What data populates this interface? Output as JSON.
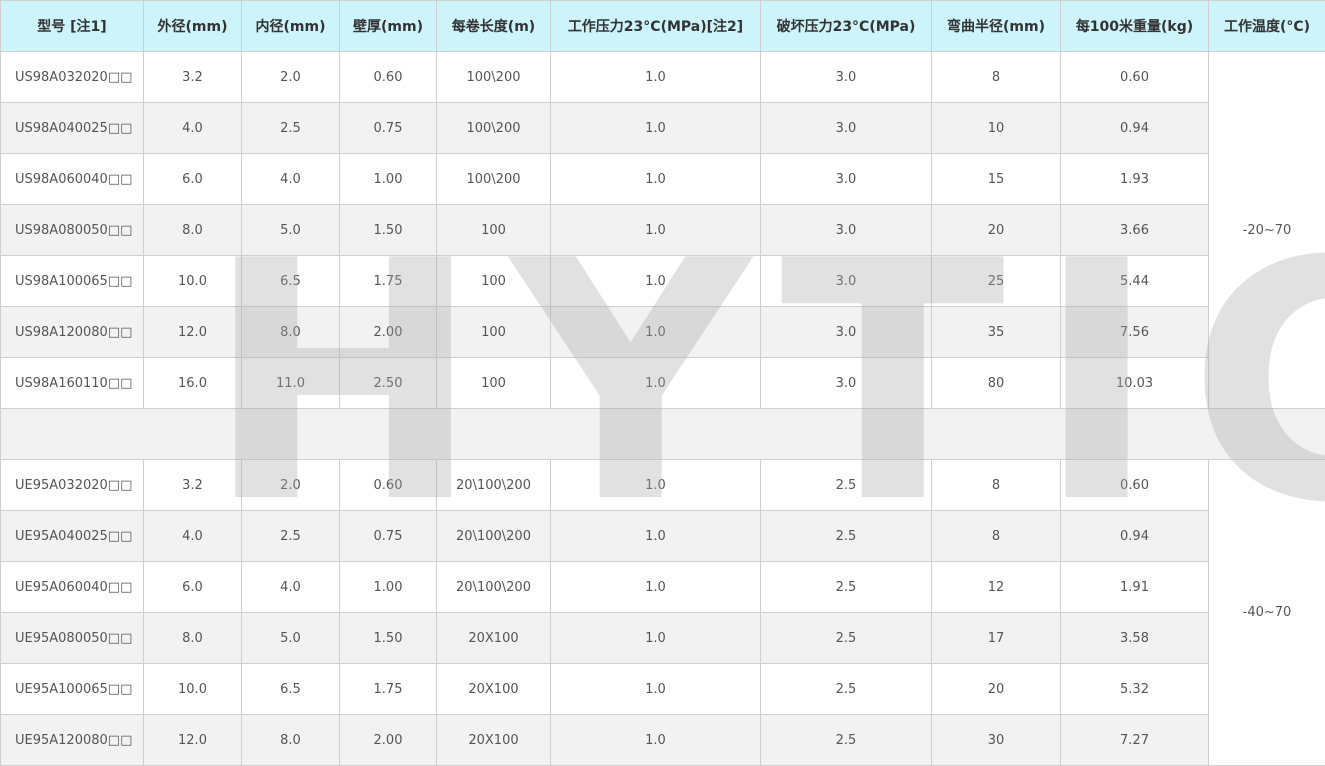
{
  "table": {
    "headers": [
      "型号 [注1]",
      "外径(mm)",
      "内径(mm)",
      "壁厚(mm)",
      "每卷长度(m)",
      "工作压力23°C(MPa)[注2]",
      "破坏压力23°C(MPa)",
      "弯曲半径(mm)",
      "每100米重量(kg)",
      "工作温度(°C)"
    ],
    "group1": {
      "temperature": "-20~70",
      "rows": [
        [
          "US98A032020□□",
          "3.2",
          "2.0",
          "0.60",
          "100\\200",
          "1.0",
          "3.0",
          "8",
          "0.60"
        ],
        [
          "US98A040025□□",
          "4.0",
          "2.5",
          "0.75",
          "100\\200",
          "1.0",
          "3.0",
          "10",
          "0.94"
        ],
        [
          "US98A060040□□",
          "6.0",
          "4.0",
          "1.00",
          "100\\200",
          "1.0",
          "3.0",
          "15",
          "1.93"
        ],
        [
          "US98A080050□□",
          "8.0",
          "5.0",
          "1.50",
          "100",
          "1.0",
          "3.0",
          "20",
          "3.66"
        ],
        [
          "US98A100065□□",
          "10.0",
          "6.5",
          "1.75",
          "100",
          "1.0",
          "3.0",
          "25",
          "5.44"
        ],
        [
          "US98A120080□□",
          "12.0",
          "8.0",
          "2.00",
          "100",
          "1.0",
          "3.0",
          "35",
          "7.56"
        ],
        [
          "US98A160110□□",
          "16.0",
          "11.0",
          "2.50",
          "100",
          "1.0",
          "3.0",
          "80",
          "10.03"
        ]
      ]
    },
    "group2": {
      "temperature": "-40~70",
      "rows": [
        [
          "UE95A032020□□",
          "3.2",
          "2.0",
          "0.60",
          "20\\100\\200",
          "1.0",
          "2.5",
          "8",
          "0.60"
        ],
        [
          "UE95A040025□□",
          "4.0",
          "2.5",
          "0.75",
          "20\\100\\200",
          "1.0",
          "2.5",
          "8",
          "0.94"
        ],
        [
          "UE95A060040□□",
          "6.0",
          "4.0",
          "1.00",
          "20\\100\\200",
          "1.0",
          "2.5",
          "12",
          "1.91"
        ],
        [
          "UE95A080050□□",
          "8.0",
          "5.0",
          "1.50",
          "20X100",
          "1.0",
          "2.5",
          "17",
          "3.58"
        ],
        [
          "UE95A100065□□",
          "10.0",
          "6.5",
          "1.75",
          "20X100",
          "1.0",
          "2.5",
          "20",
          "5.32"
        ],
        [
          "UE95A120080□□",
          "12.0",
          "8.0",
          "2.00",
          "20X100",
          "1.0",
          "2.5",
          "30",
          "7.27"
        ]
      ]
    }
  },
  "watermark": "HYTIC"
}
